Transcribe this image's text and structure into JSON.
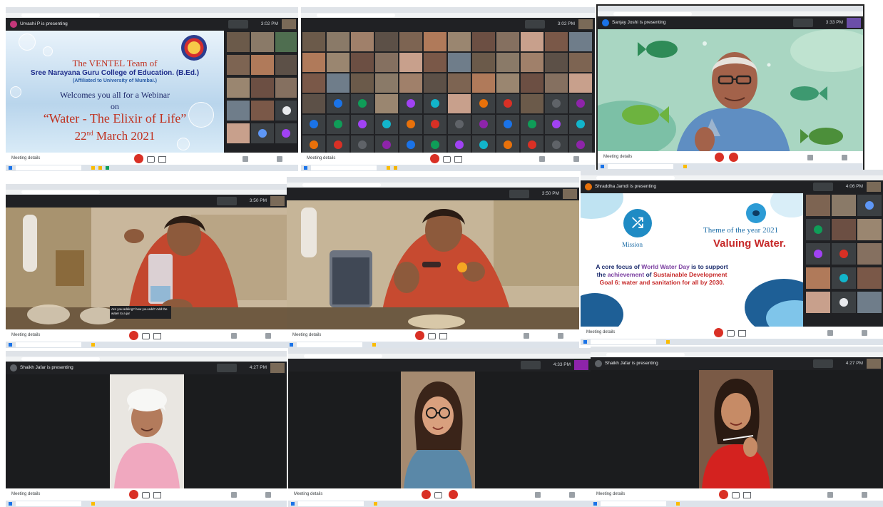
{
  "colors": {
    "meet_dark": "#202124",
    "end_call_red": "#d93025",
    "slide_red": "#c0311f",
    "slide_navy": "#1f2d8c",
    "valuing_red": "#c62828"
  },
  "panel1": {
    "presenter": "Urvashi P is presenting",
    "slide": {
      "line1": "The VENTEL Team of",
      "line2": "Sree Narayana Guru College of Education. (B.Ed.)",
      "line3": "(Affiliated to University of Mumbai.)",
      "line4": "Welcomes you all for a Webinar",
      "line5": "on",
      "line6": "“Water - The Elixir of Life”",
      "date_day": "22",
      "date_suffix": "nd",
      "date_rest": " March 2021"
    },
    "meeting_details": "Meeting details",
    "time": "3:02 PM"
  },
  "panel2": {
    "meeting_details": "Meeting details",
    "time": "3:02 PM"
  },
  "panel3": {
    "presenter": "Sanjay Joshi is presenting",
    "meeting_details": "Meeting details",
    "time": "3:33 PM",
    "icons": [
      "fish-icon",
      "microphone-icon",
      "end-call-icon"
    ]
  },
  "panel4": {
    "meeting_details": "Meeting details",
    "time": "3:50 PM",
    "caption": "Are you adding? how you add? Add the water to a jar"
  },
  "panel5": {
    "meeting_details": "Meeting details",
    "time": "3:50 PM"
  },
  "panel6": {
    "presenter": "Shraddha Jamdi is presenting",
    "time": "4:06 PM",
    "meeting_details": "Meeting details",
    "slide": {
      "mission": "Mission",
      "theme": "Theme of the year 2021",
      "valuing": "Valuing Water.",
      "body_a": "A core focus of ",
      "body_b": "World Water Day",
      "body_c": " is to support the ",
      "body_d": "achievement",
      "body_e": " of ",
      "body_f": "Sustainable Development Goal 6: water and sanitation for all by 2030."
    }
  },
  "panel7": {
    "presenter": "Shaikh Jafar is presenting",
    "time": "4:27 PM",
    "meeting_details": "Meeting details"
  },
  "panel8": {
    "time": "4:33 PM",
    "meeting_details": "Meeting details"
  },
  "panel9": {
    "presenter": "Shaikh Jafar is presenting",
    "time": "4:27 PM",
    "meeting_details": "Meeting details"
  }
}
